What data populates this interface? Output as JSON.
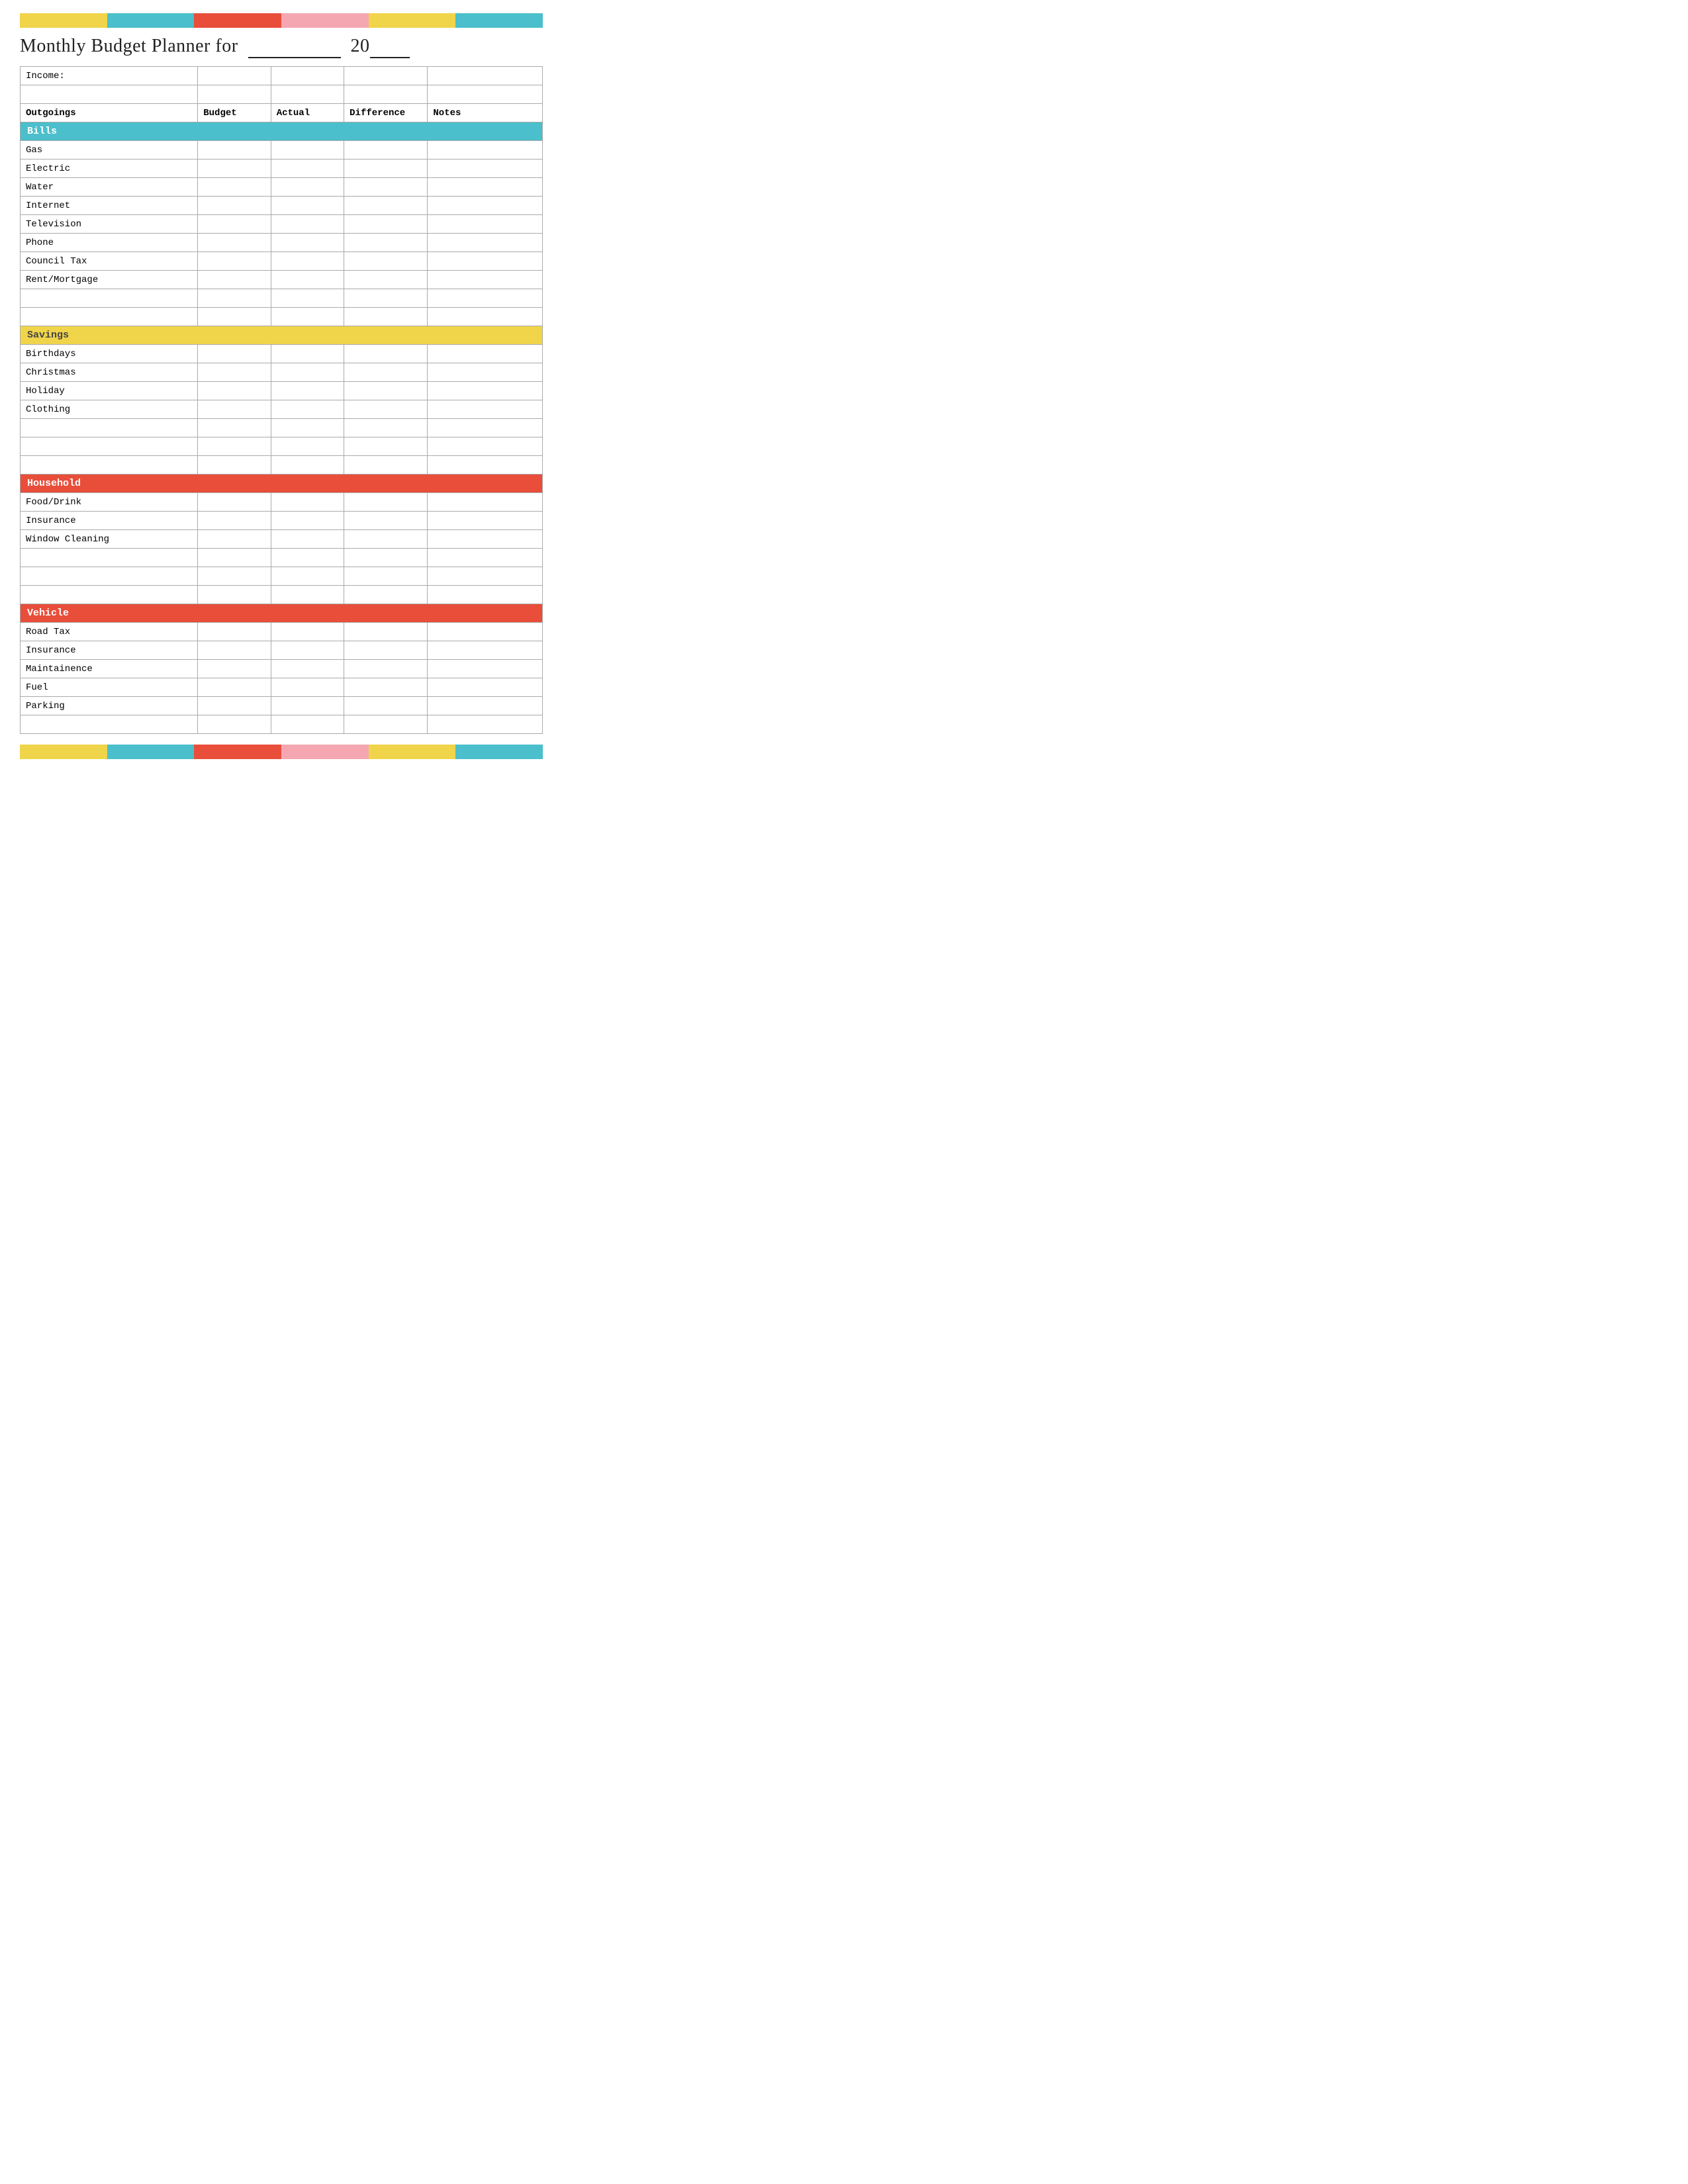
{
  "topBar": {
    "segments": [
      {
        "color": "#f0d44a"
      },
      {
        "color": "#f0d44a"
      },
      {
        "color": "#4bbfcb"
      },
      {
        "color": "#4bbfcb"
      },
      {
        "color": "#e84e3a"
      },
      {
        "color": "#e84e3a"
      },
      {
        "color": "#f4a7b0"
      },
      {
        "color": "#f4a7b0"
      },
      {
        "color": "#f0d44a"
      },
      {
        "color": "#f0d44a"
      },
      {
        "color": "#4bbfcb"
      },
      {
        "color": "#4bbfcb"
      }
    ]
  },
  "bottomBar": {
    "segments": [
      {
        "color": "#f0d44a"
      },
      {
        "color": "#f0d44a"
      },
      {
        "color": "#4bbfcb"
      },
      {
        "color": "#4bbfcb"
      },
      {
        "color": "#e84e3a"
      },
      {
        "color": "#e84e3a"
      },
      {
        "color": "#f4a7b0"
      },
      {
        "color": "#f4a7b0"
      },
      {
        "color": "#f0d44a"
      },
      {
        "color": "#f0d44a"
      },
      {
        "color": "#4bbfcb"
      },
      {
        "color": "#4bbfcb"
      }
    ]
  },
  "title": {
    "prefix": "Monthly Budget Planner for",
    "year_prefix": "20"
  },
  "table": {
    "income_label": "Income:",
    "headers": {
      "outgoings": "Outgoings",
      "budget": "Budget",
      "actual": "Actual",
      "difference": "Difference",
      "notes": "Notes"
    },
    "sections": [
      {
        "name": "Bills",
        "color_class": "cat-bills",
        "items": [
          "Gas",
          "Electric",
          "Water",
          "Internet",
          "Television",
          "Phone",
          "Council Tax",
          "Rent/Mortgage"
        ]
      },
      {
        "name": "Savings",
        "color_class": "cat-savings",
        "items": [
          "Birthdays",
          "Christmas",
          "Holiday",
          "Clothing"
        ]
      },
      {
        "name": "Household",
        "color_class": "cat-household",
        "items": [
          "Food/Drink",
          "Insurance",
          "Window Cleaning"
        ]
      },
      {
        "name": "Vehicle",
        "color_class": "cat-vehicle",
        "items": [
          "Road Tax",
          "Insurance",
          "Maintainence",
          "Fuel",
          "Parking"
        ]
      }
    ]
  }
}
